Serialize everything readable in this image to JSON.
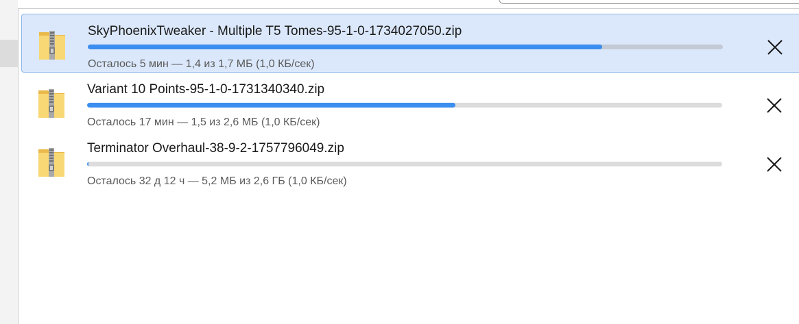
{
  "colors": {
    "selected_background": "#dbe8fb",
    "selected_border": "#8fb6e8",
    "progress_fill": "#3b8def",
    "progress_track": "#dcdcdc"
  },
  "downloads": [
    {
      "file_name": "SkyPhoenixTweaker - Multiple T5 Tomes-95-1-0-1734027050.zip",
      "status": "Осталось 5 мин — 1,4 из 1,7 МБ (1,0 КБ/сек)",
      "progress_percent": 81,
      "selected": true,
      "icon": "zip-folder-icon"
    },
    {
      "file_name": "Variant 10 Points-95-1-0-1731340340.zip",
      "status": "Осталось 17 мин — 1,5 из 2,6 МБ (1,0 КБ/сек)",
      "progress_percent": 58,
      "selected": false,
      "icon": "zip-folder-icon"
    },
    {
      "file_name": "Terminator Overhaul-38-9-2-1757796049.zip",
      "status": "Осталось 32 д 12 ч — 5,2 МБ из 2,6 ГБ (1,0 КБ/сек)",
      "progress_percent": 0.2,
      "selected": false,
      "icon": "zip-folder-icon"
    }
  ]
}
